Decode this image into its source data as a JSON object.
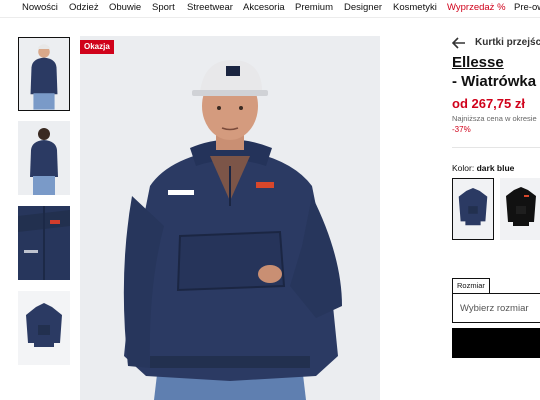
{
  "nav": {
    "items": [
      "Nowości",
      "Odzież",
      "Obuwie",
      "Sport",
      "Streetwear",
      "Akcesoria",
      "Premium",
      "Designer",
      "Kosmetyki",
      "Wyprzedaż %",
      "Pre-ow"
    ]
  },
  "gallery": {
    "badge": "Okazja",
    "thumbnail_icons": [
      "model-front-icon",
      "model-back-icon",
      "fabric-detail-icon",
      "product-flat-icon"
    ]
  },
  "product": {
    "breadcrumb": "Kurtki przejściowe",
    "brand": "Ellesse",
    "name": "- Wiatrówka",
    "price": "od 267,75 zł",
    "lowest_price_note": "Najniższa cena w okresie",
    "discount": "-37%",
    "color_label": "Kolor:",
    "color_value": "dark blue",
    "size_label": "Rozmiar",
    "size_placeholder": "Wybierz rozmiar"
  },
  "colors": {
    "accent": "#d0021b",
    "jacket": "#2b3a63",
    "black": "#000000"
  }
}
